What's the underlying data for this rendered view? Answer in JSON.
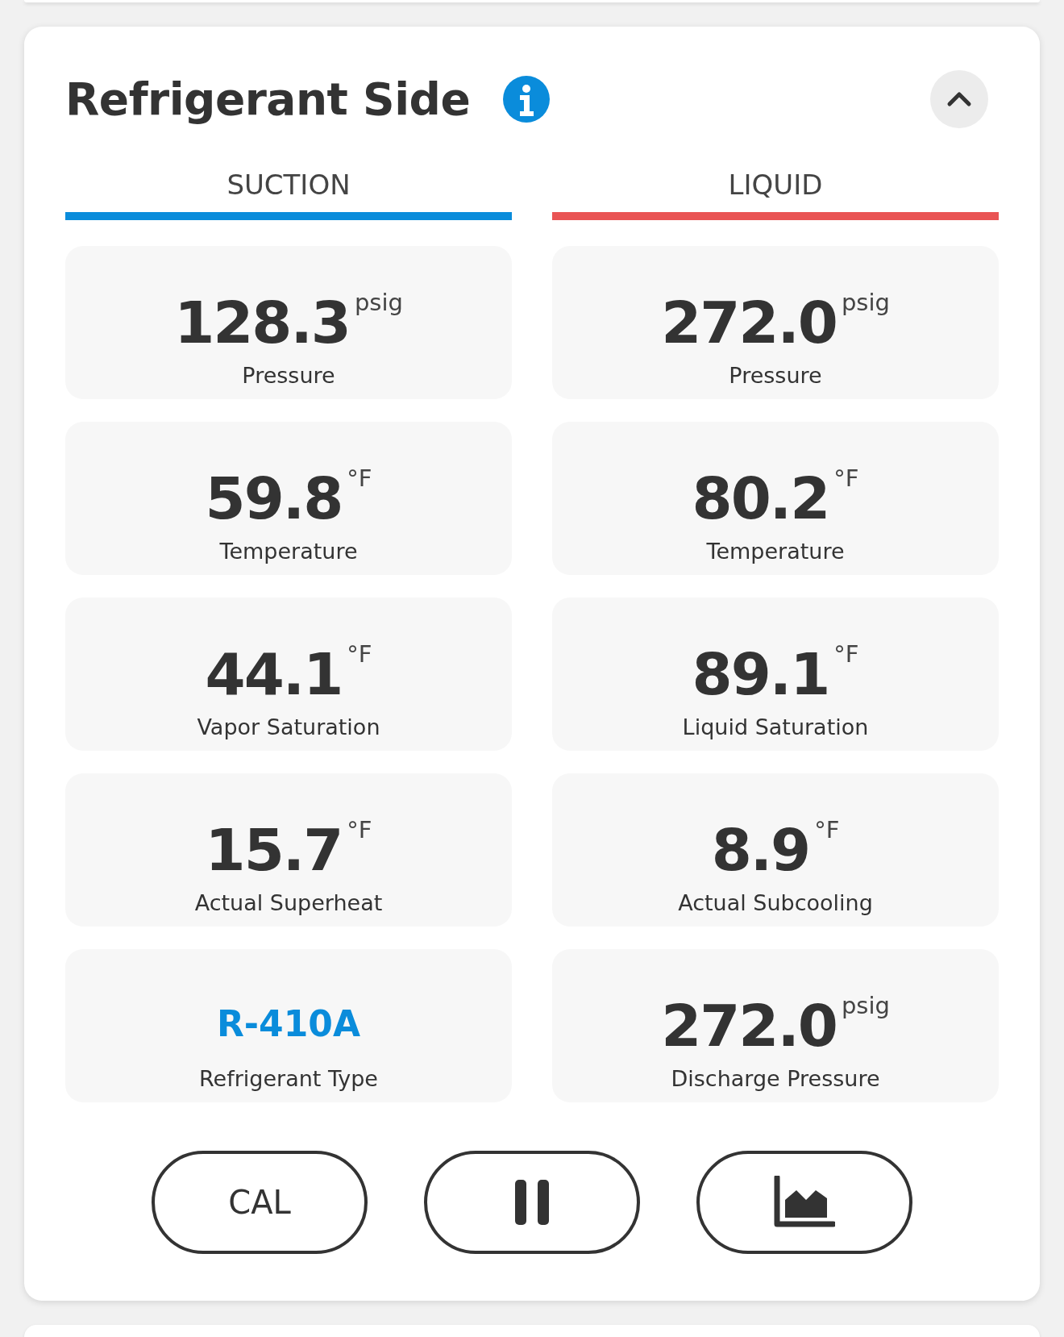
{
  "section": {
    "title": "Refrigerant Side",
    "expanded": true
  },
  "columns": [
    {
      "label": "SUCTION",
      "color": "#0a8cdb",
      "tiles": [
        {
          "kind": "reading",
          "value": "128.3",
          "unit": "psig",
          "label": "Pressure"
        },
        {
          "kind": "reading",
          "value": "59.8",
          "unit": "°F",
          "label": "Temperature"
        },
        {
          "kind": "reading",
          "value": "44.1",
          "unit": "°F",
          "label": "Vapor Saturation"
        },
        {
          "kind": "reading",
          "value": "15.7",
          "unit": "°F",
          "label": "Actual Superheat"
        },
        {
          "kind": "link",
          "value": "R-410A",
          "label": "Refrigerant Type"
        }
      ]
    },
    {
      "label": "LIQUID",
      "color": "#e95454",
      "tiles": [
        {
          "kind": "reading",
          "value": "272.0",
          "unit": "psig",
          "label": "Pressure"
        },
        {
          "kind": "reading",
          "value": "80.2",
          "unit": "°F",
          "label": "Temperature"
        },
        {
          "kind": "reading",
          "value": "89.1",
          "unit": "°F",
          "label": "Liquid Saturation"
        },
        {
          "kind": "reading",
          "value": "8.9",
          "unit": "°F",
          "label": "Actual Subcooling"
        },
        {
          "kind": "reading",
          "value": "272.0",
          "unit": "psig",
          "label": "Discharge Pressure"
        }
      ]
    }
  ],
  "buttons": [
    {
      "kind": "text",
      "label": "CAL"
    },
    {
      "kind": "pause"
    },
    {
      "kind": "chart"
    }
  ]
}
